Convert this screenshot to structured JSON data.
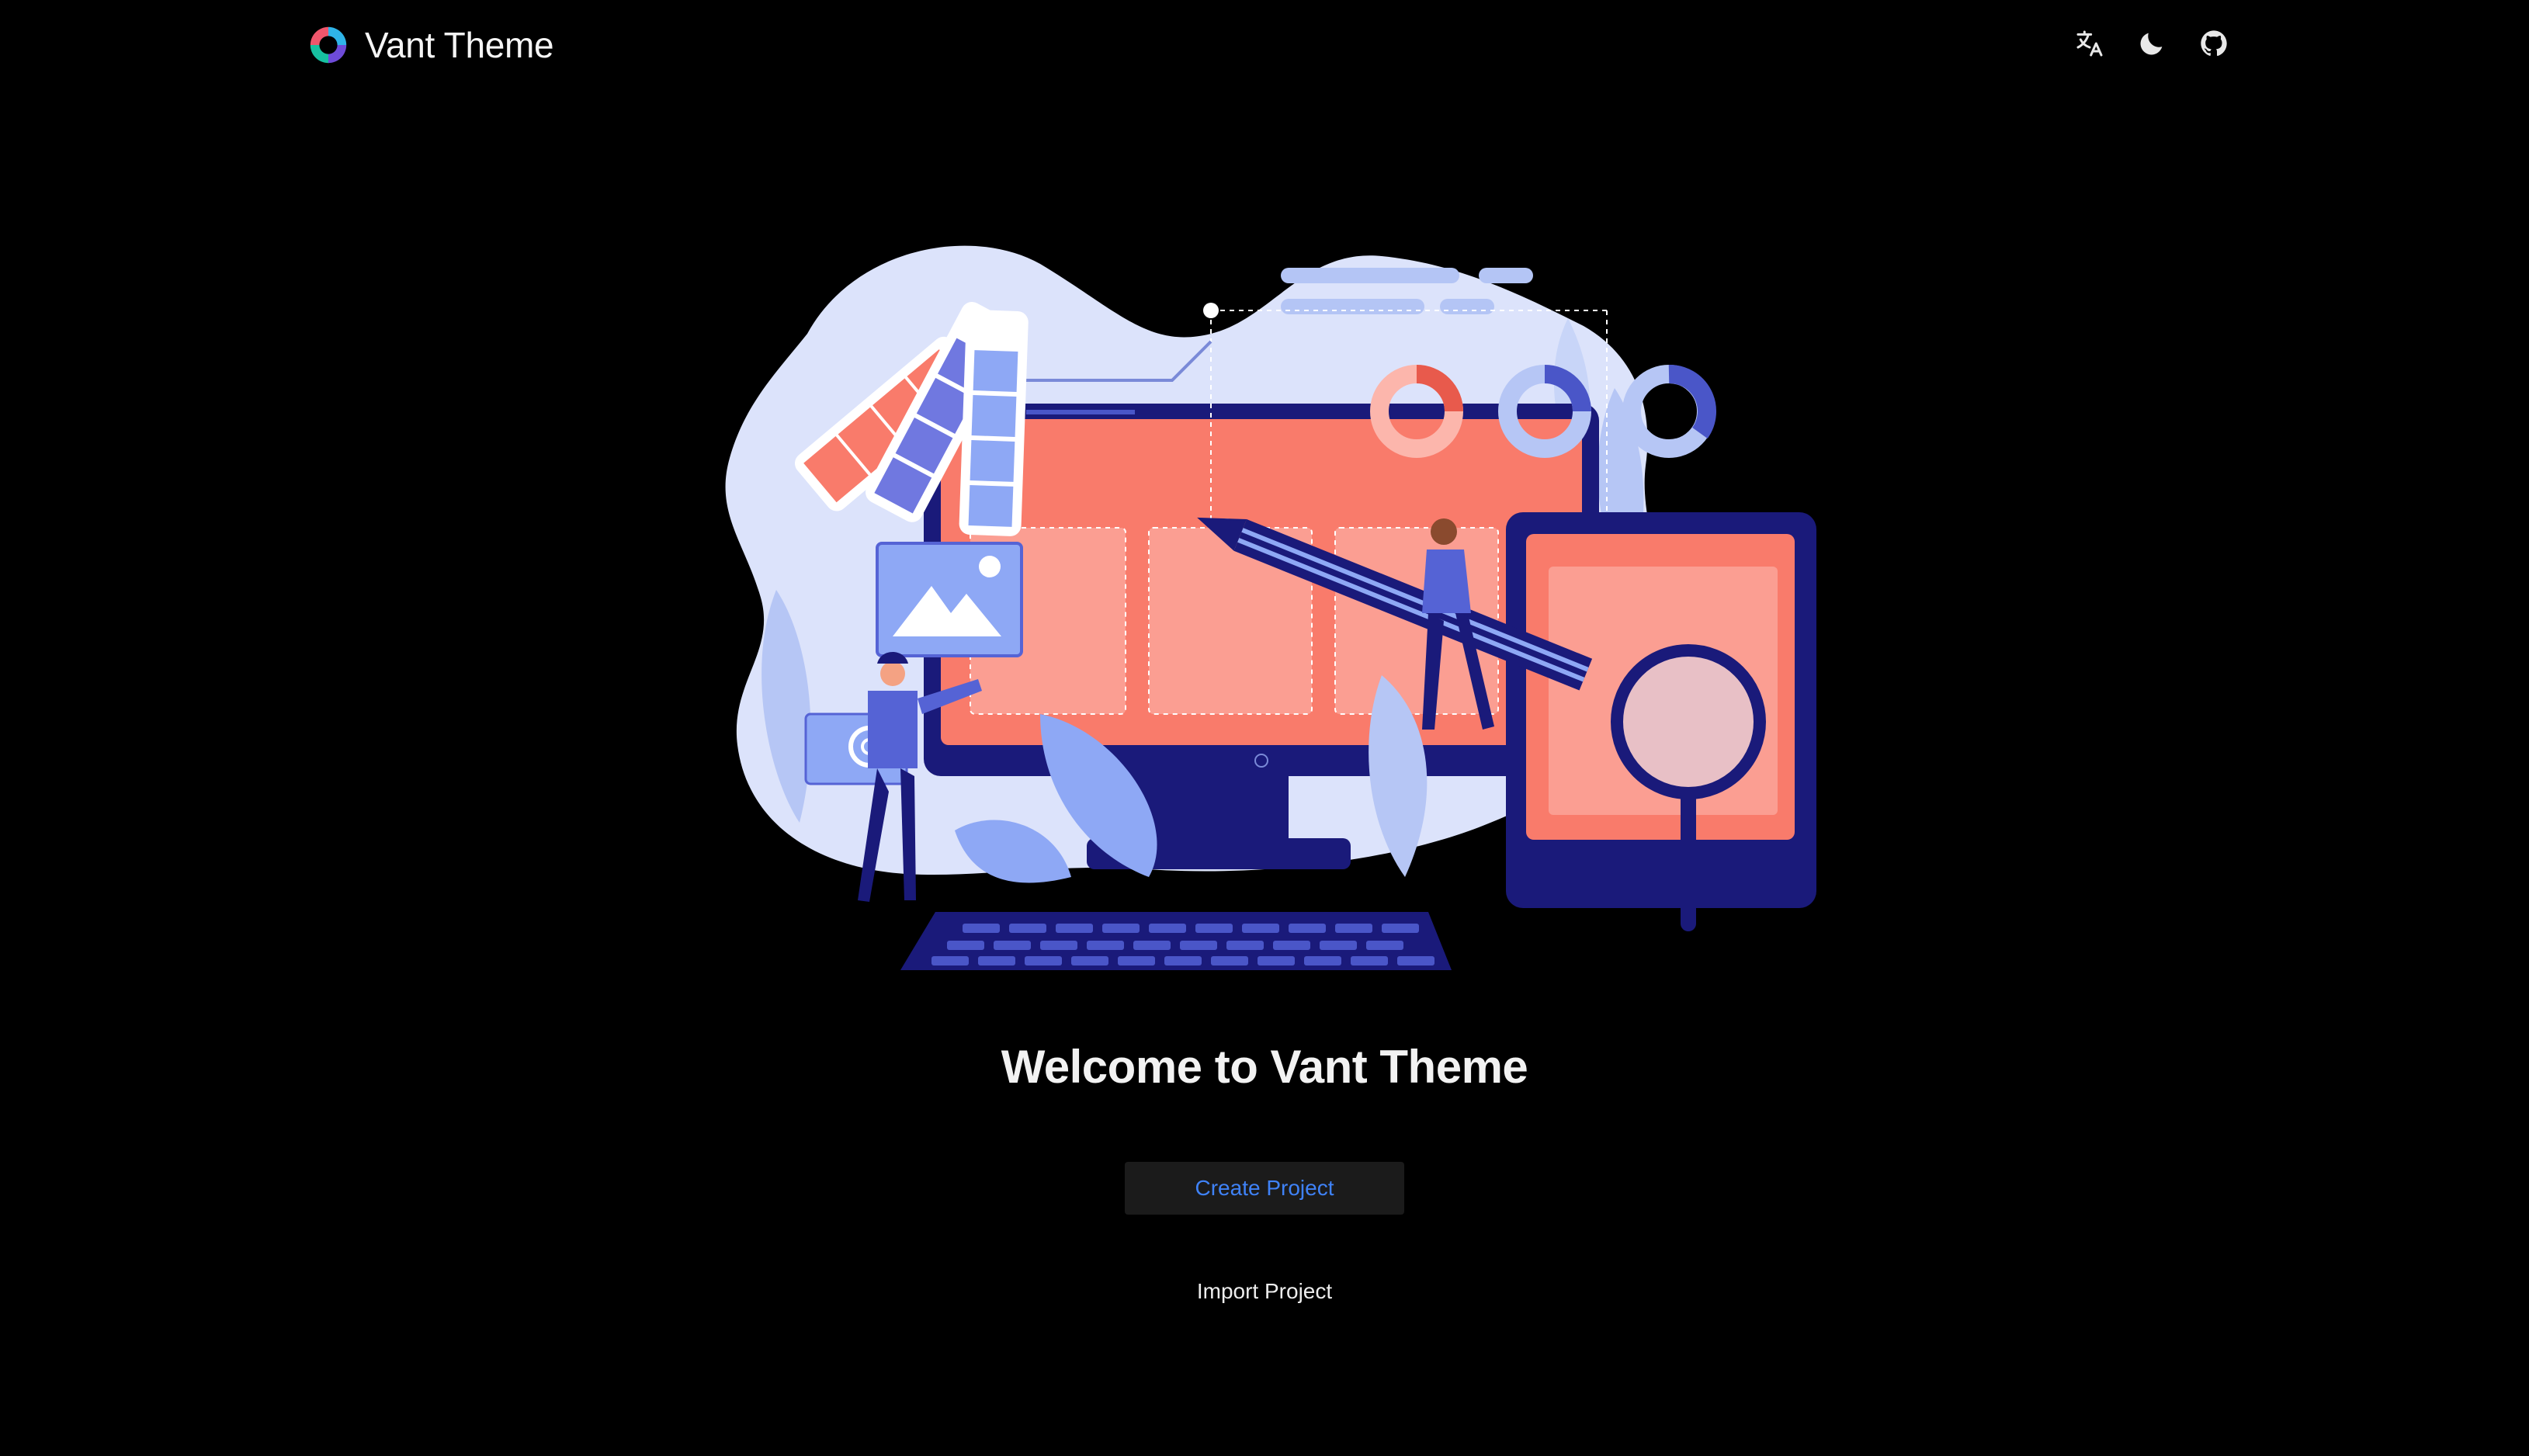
{
  "header": {
    "brand_title": "Vant Theme",
    "logo_icon": "vant-logo-icon",
    "actions": [
      {
        "name": "translate-icon"
      },
      {
        "name": "dark-mode-moon-icon"
      },
      {
        "name": "github-icon"
      }
    ]
  },
  "main": {
    "welcome_title": "Welcome to Vant Theme",
    "create_button_label": "Create Project",
    "import_link_label": "Import Project"
  },
  "colors": {
    "background": "#000000",
    "accent_blue": "#3f82f7",
    "button_bg": "#1b1b1b",
    "illustration_coral": "#f97b6b",
    "illustration_navy": "#1a1a7a",
    "illustration_lavender": "#dce3fb"
  }
}
